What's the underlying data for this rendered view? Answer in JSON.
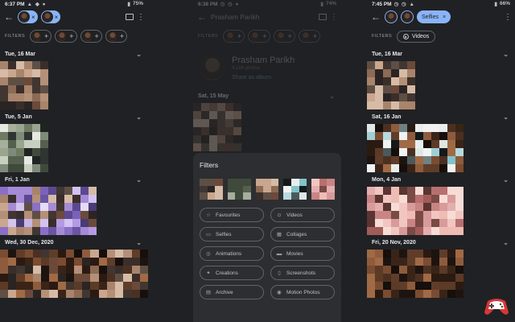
{
  "screens": [
    {
      "status": {
        "time": "6:37 PM",
        "battery": "75%"
      },
      "appbar": {
        "chips": [
          {
            "close": "×"
          },
          {
            "close": "×"
          }
        ]
      },
      "filters": {
        "label": "FILTERS"
      },
      "sections": [
        {
          "date": "Tue, 16 Mar"
        },
        {
          "date": "Tue, 5 Jan"
        },
        {
          "date": "Fri, 1 Jan"
        },
        {
          "date": "Wed, 30 Dec, 2020"
        }
      ]
    },
    {
      "status": {
        "time": "6:38 PM",
        "battery": "74%"
      },
      "appbar": {
        "title": "Prasham Parikh"
      },
      "filters": {
        "label": "FILTERS"
      },
      "person": {
        "name": "Prasham Parikh",
        "count": "4,194 photos",
        "share": "Share as album"
      },
      "section": {
        "date": "Sat, 15 May"
      },
      "sheet": {
        "title": "Filters",
        "items": [
          {
            "label": "Favourites",
            "icon": "star-icon"
          },
          {
            "label": "Videos",
            "icon": "play-icon"
          },
          {
            "label": "Selfies",
            "icon": "selfie-icon"
          },
          {
            "label": "Collages",
            "icon": "collage-icon"
          },
          {
            "label": "Animations",
            "icon": "animation-icon"
          },
          {
            "label": "Movies",
            "icon": "movie-icon"
          },
          {
            "label": "Creations",
            "icon": "creations-icon"
          },
          {
            "label": "Screenshots",
            "icon": "screenshot-icon"
          },
          {
            "label": "Archive",
            "icon": "archive-icon"
          },
          {
            "label": "Motion Photos",
            "icon": "motion-icon"
          }
        ]
      }
    },
    {
      "status": {
        "time": "7:45 PM",
        "battery": "66%"
      },
      "appbar": {
        "chip_label": "Selfies",
        "close": "×"
      },
      "filters": {
        "label": "FILTERS",
        "chip": "Videos"
      },
      "sections": [
        {
          "date": "Tue, 16 Mar"
        },
        {
          "date": "Sat, 16 Jan"
        },
        {
          "date": "Mon, 4 Jan"
        },
        {
          "date": "Fri, 20 Nov, 2020"
        }
      ]
    }
  ],
  "colors": {
    "background": "#202124",
    "accent": "#8ab4f8",
    "sheet": "#2d2e31",
    "outline": "#5f6368"
  }
}
